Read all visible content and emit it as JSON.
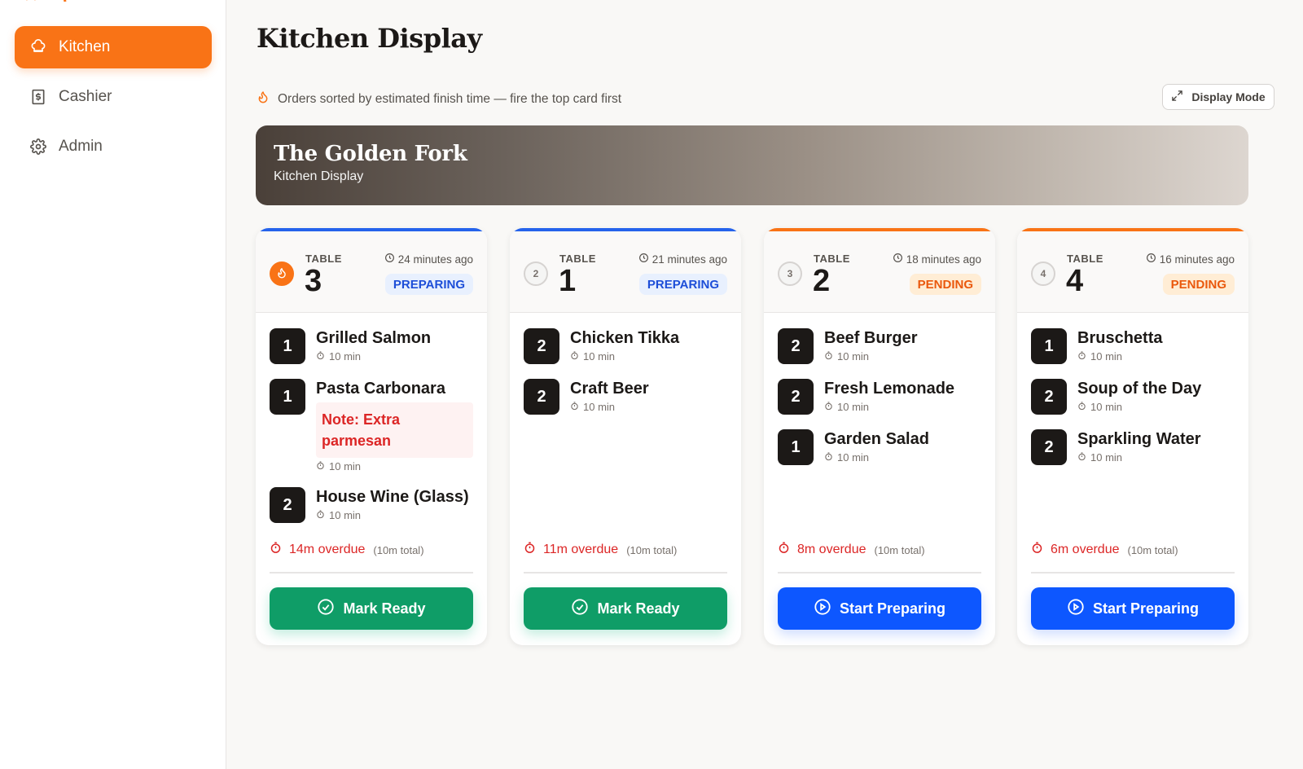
{
  "sidebar": {
    "items": [
      {
        "label": "Kitchen",
        "icon": "chef-hat-icon",
        "active": true
      },
      {
        "label": "Cashier",
        "icon": "dollar-receipt-icon",
        "active": false
      },
      {
        "label": "Admin",
        "icon": "gear-icon",
        "active": false
      }
    ]
  },
  "header": {
    "title": "Kitchen Display",
    "hint": "Orders sorted by estimated finish time — fire the top card first",
    "display_mode_label": "Display Mode"
  },
  "banner": {
    "title": "The Golden Fork",
    "subtitle": "Kitchen Display"
  },
  "colors": {
    "accent": "#f97316",
    "preparing": "#1d4ed8",
    "pending": "#ea580c",
    "ready_button": "#0f9d67",
    "start_button": "#0d57ff",
    "overdue": "#dc2626"
  },
  "orders": [
    {
      "sequence": "",
      "table_label": "TABLE",
      "table": "3",
      "ago": "24 minutes ago",
      "status": "PREPARING",
      "items": [
        {
          "qty": "1",
          "name": "Grilled Salmon",
          "time": "10 min",
          "note": ""
        },
        {
          "qty": "1",
          "name": "Pasta Carbonara",
          "time": "10 min",
          "note": "Note: Extra parmesan"
        },
        {
          "qty": "2",
          "name": "House Wine (Glass)",
          "time": "10 min",
          "note": ""
        }
      ],
      "overdue": "14m overdue",
      "total": "(10m total)",
      "action": "Mark Ready"
    },
    {
      "sequence": "2",
      "table_label": "TABLE",
      "table": "1",
      "ago": "21 minutes ago",
      "status": "PREPARING",
      "items": [
        {
          "qty": "2",
          "name": "Chicken Tikka",
          "time": "10 min",
          "note": ""
        },
        {
          "qty": "2",
          "name": "Craft Beer",
          "time": "10 min",
          "note": ""
        }
      ],
      "overdue": "11m overdue",
      "total": "(10m total)",
      "action": "Mark Ready"
    },
    {
      "sequence": "3",
      "table_label": "TABLE",
      "table": "2",
      "ago": "18 minutes ago",
      "status": "PENDING",
      "items": [
        {
          "qty": "2",
          "name": "Beef Burger",
          "time": "10 min",
          "note": ""
        },
        {
          "qty": "2",
          "name": "Fresh Lemonade",
          "time": "10 min",
          "note": ""
        },
        {
          "qty": "1",
          "name": "Garden Salad",
          "time": "10 min",
          "note": ""
        }
      ],
      "overdue": "8m overdue",
      "total": "(10m total)",
      "action": "Start Preparing"
    },
    {
      "sequence": "4",
      "table_label": "TABLE",
      "table": "4",
      "ago": "16 minutes ago",
      "status": "PENDING",
      "items": [
        {
          "qty": "1",
          "name": "Bruschetta",
          "time": "10 min",
          "note": ""
        },
        {
          "qty": "2",
          "name": "Soup of the Day",
          "time": "10 min",
          "note": ""
        },
        {
          "qty": "2",
          "name": "Sparkling Water",
          "time": "10 min",
          "note": ""
        }
      ],
      "overdue": "6m overdue",
      "total": "(10m total)",
      "action": "Start Preparing"
    }
  ]
}
